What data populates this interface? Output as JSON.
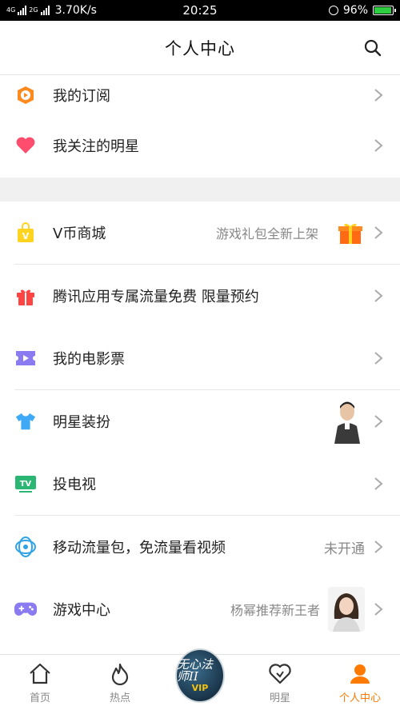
{
  "status_bar": {
    "network_4g": "4G",
    "network_2g": "2G",
    "speed": "3.70K/s",
    "time": "20:25",
    "battery": "96%",
    "battery_level": 0.96
  },
  "header": {
    "title": "个人中心",
    "search_icon": "search-icon"
  },
  "menu": {
    "subscription": {
      "label": "我的订阅",
      "icon": "play-subscription-icon",
      "color": "#ff8a1f"
    },
    "followed_stars": {
      "label": "我关注的明星",
      "icon": "heart-icon",
      "color": "#ff4d6d"
    },
    "vcoin_mall": {
      "label": "V币商城",
      "hint": "游戏礼包全新上架",
      "icon": "shopping-bag-icon",
      "color": "#ffd31f"
    },
    "tencent_data": {
      "label": "腾讯应用专属流量免费 限量预约",
      "icon": "gift-box-icon",
      "color": "#ff4444"
    },
    "movie_tickets": {
      "label": "我的电影票",
      "icon": "ticket-play-icon",
      "color": "#8b7bf0"
    },
    "star_outfit": {
      "label": "明星装扮",
      "icon": "tshirt-icon",
      "color": "#3fa9f5"
    },
    "cast_tv": {
      "label": "投电视",
      "icon": "tv-icon",
      "color": "#2bb673"
    },
    "mobile_data": {
      "label": "移动流量包，免流量看视频",
      "hint": "未开通",
      "icon": "china-mobile-icon",
      "color": "#2fa3e6"
    },
    "game_center": {
      "label": "游戏中心",
      "hint": "杨幂推荐新王者",
      "icon": "gamepad-icon",
      "color": "#8b7bf0"
    }
  },
  "tabbar": {
    "home": "首页",
    "hot": "热点",
    "vip_badge": "无心法师II",
    "vip_sub": "VIP",
    "stars": "明星",
    "profile": "个人中心",
    "active_color": "#ff7a00"
  }
}
